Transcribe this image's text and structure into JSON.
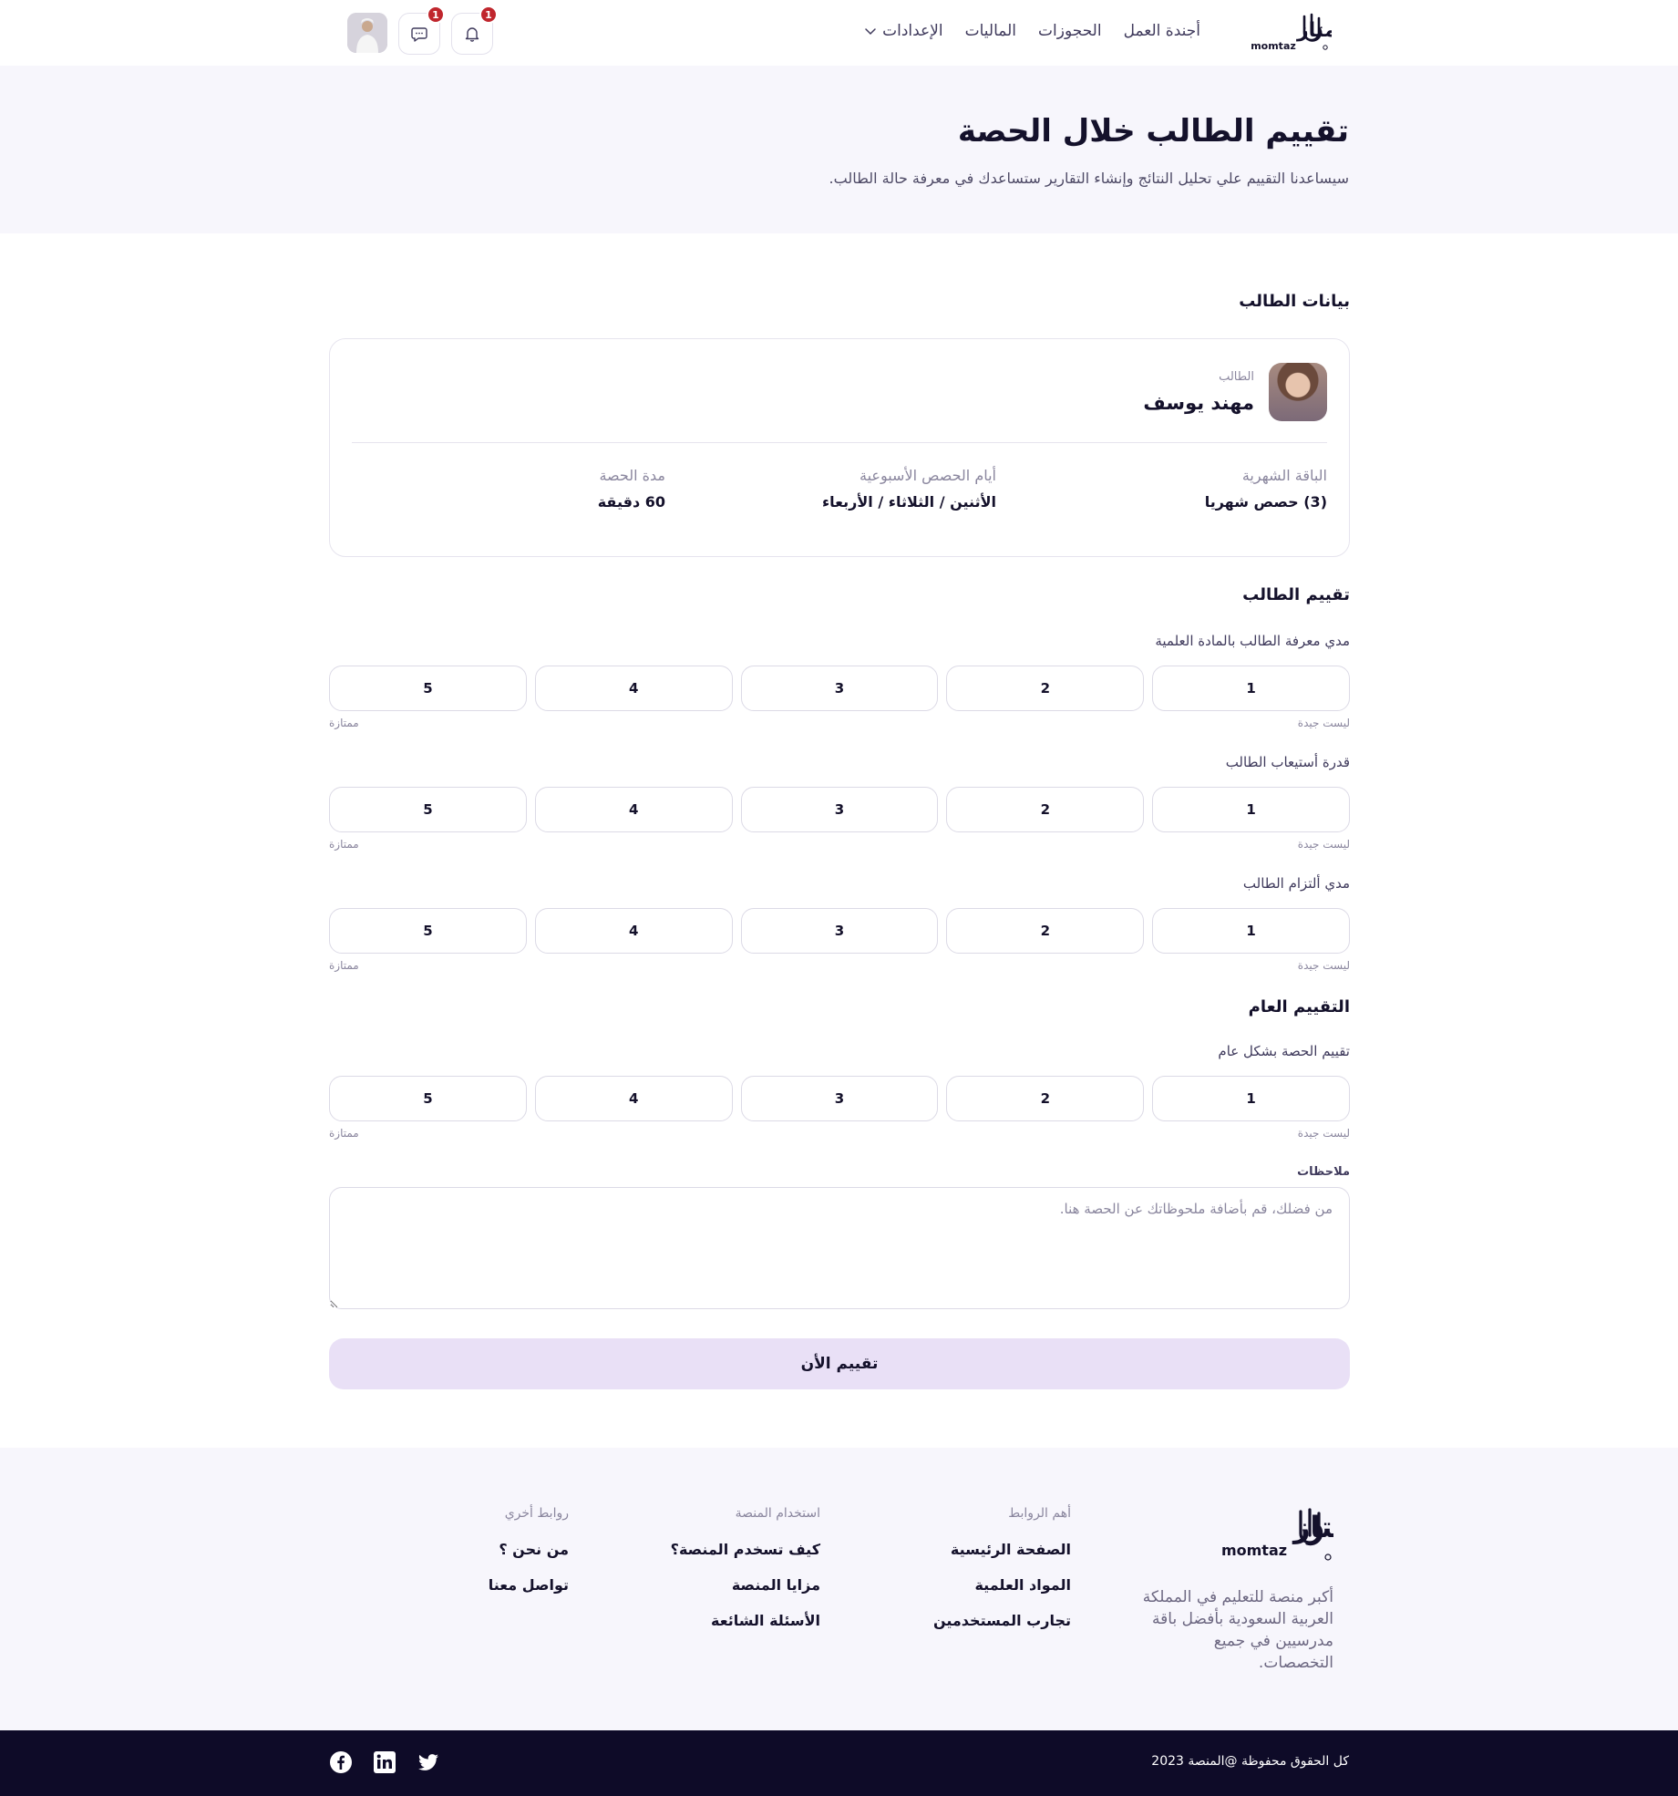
{
  "header": {
    "logo_arabic": "ممتاز",
    "logo_latin": "momtaz",
    "nav": [
      {
        "label": "أجندة العمل"
      },
      {
        "label": "الحجوزات"
      },
      {
        "label": "الماليات"
      },
      {
        "label": "الإعدادات",
        "has_dropdown": true
      }
    ],
    "notifications_count": "1",
    "messages_count": "1"
  },
  "hero": {
    "title": "تقييم الطالب خلال الحصة",
    "subtitle": "سيساعدنا التقييم علي تحليل النتائج وإنشاء التقارير ستساعدك في معرفة حالة الطالب."
  },
  "student_section": {
    "title": "بيانات الطالب",
    "label": "الطالب",
    "name": "مهند يوسف",
    "info": [
      {
        "label": "الباقة الشهرية",
        "value": "(3) حصص شهريا"
      },
      {
        "label": "أيام الحصص الأسبوعية",
        "value": "الأثنين / الثلاثاء / الأربعاء"
      },
      {
        "label": "مدة الحصة",
        "value": "60 دقيقة"
      }
    ]
  },
  "rating_section": {
    "title": "تقييم الطالب",
    "questions": [
      {
        "label": "مدي معرفة الطالب بالمادة العلمية"
      },
      {
        "label": "قدرة أستيعاب الطالب"
      },
      {
        "label": "مدي ألتزام الطالب"
      }
    ]
  },
  "overall_section": {
    "title": "التقييم العام",
    "question": "تقييم الحصة بشكل عام"
  },
  "scale": {
    "options": [
      "1",
      "2",
      "3",
      "4",
      "5"
    ],
    "low_label": "ليست جيدة",
    "high_label": "ممتازة"
  },
  "notes": {
    "label": "ملاحظات",
    "placeholder": "من فضلك، قم بأضافة ملحوظاتك عن الحصة هنا.",
    "value": ""
  },
  "submit_label": "تقييم الأن",
  "footer": {
    "description": "أكبر منصة للتعليم في المملكة العربية السعودية بأفضل باقة مدرسيين في جميع التخصصات.",
    "columns": [
      {
        "title": "أهم الروابط",
        "links": [
          "الصفحة الرئيسية",
          "المواد العلمية",
          "تجارب المستخدمين"
        ]
      },
      {
        "title": "استخدام المنصة",
        "links": [
          "كيف تسخدم المنصة؟",
          "مزايا المنصة",
          "الأسئلة الشائعة"
        ]
      },
      {
        "title": "روابط أخري",
        "links": [
          "من نحن ؟",
          "تواصل معنا"
        ]
      }
    ],
    "copyright": "كل الحقوق محفوظة @المنصة 2023",
    "socials": [
      "twitter-icon",
      "linkedin-icon",
      "facebook-icon"
    ]
  },
  "colors": {
    "primary_dark": "#14112b",
    "hero_bg": "#f7f6fc",
    "submit_bg": "#e9e0f6",
    "badge": "#c0262d",
    "bottom_bar": "#0e0b28"
  }
}
